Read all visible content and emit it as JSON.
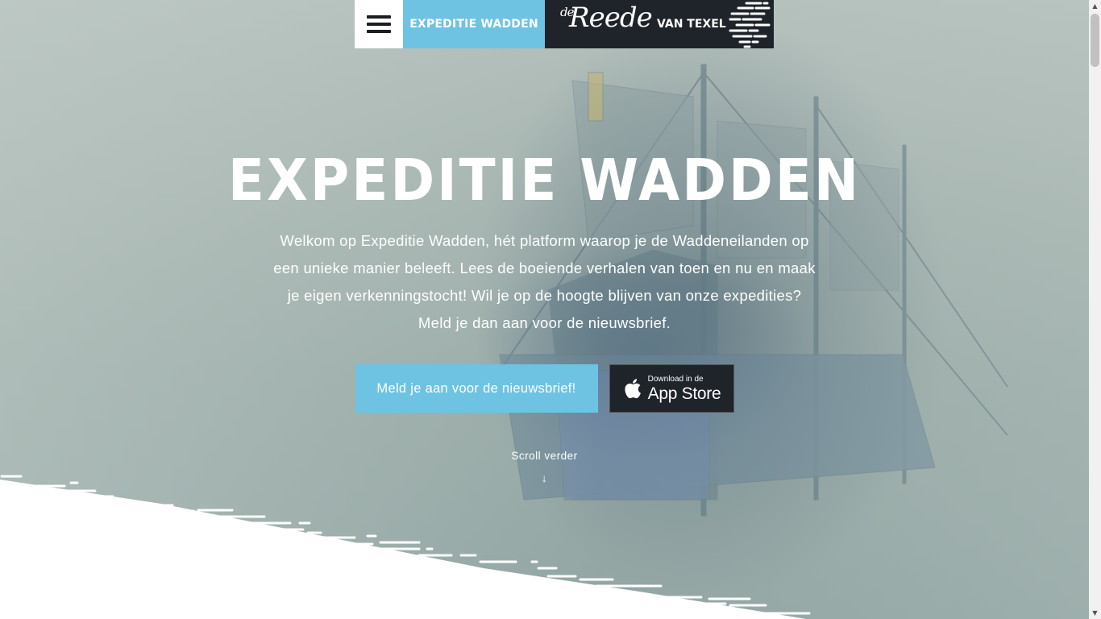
{
  "nav": {
    "menu_icon": "hamburger-icon",
    "title": "EXPEDITIE WADDEN",
    "brand_script_small": "de",
    "brand_script": "Reede",
    "brand_location": "VAN TEXEL"
  },
  "hero": {
    "heading": "EXPEDITIE WADDEN",
    "intro": "Welkom op Expeditie Wadden, hét platform waarop je de Waddeneilanden op een unieke manier beleeft. Lees de boeiende verhalen van toen en nu en maak je eigen verkenningstocht! Wil je op de hoogte blijven van onze expedities? Meld je dan aan voor de nieuwsbrief.",
    "newsletter_button": "Meld je aan voor de nieuwsbrief!",
    "appstore_small": "Download in de",
    "appstore_big": "App Store",
    "appstore_icon": "apple-icon",
    "scroll_label": "Scroll verder",
    "scroll_arrow": "↓"
  },
  "colors": {
    "accent": "#6ec3e2",
    "dark": "#1f232a",
    "white": "#ffffff"
  }
}
